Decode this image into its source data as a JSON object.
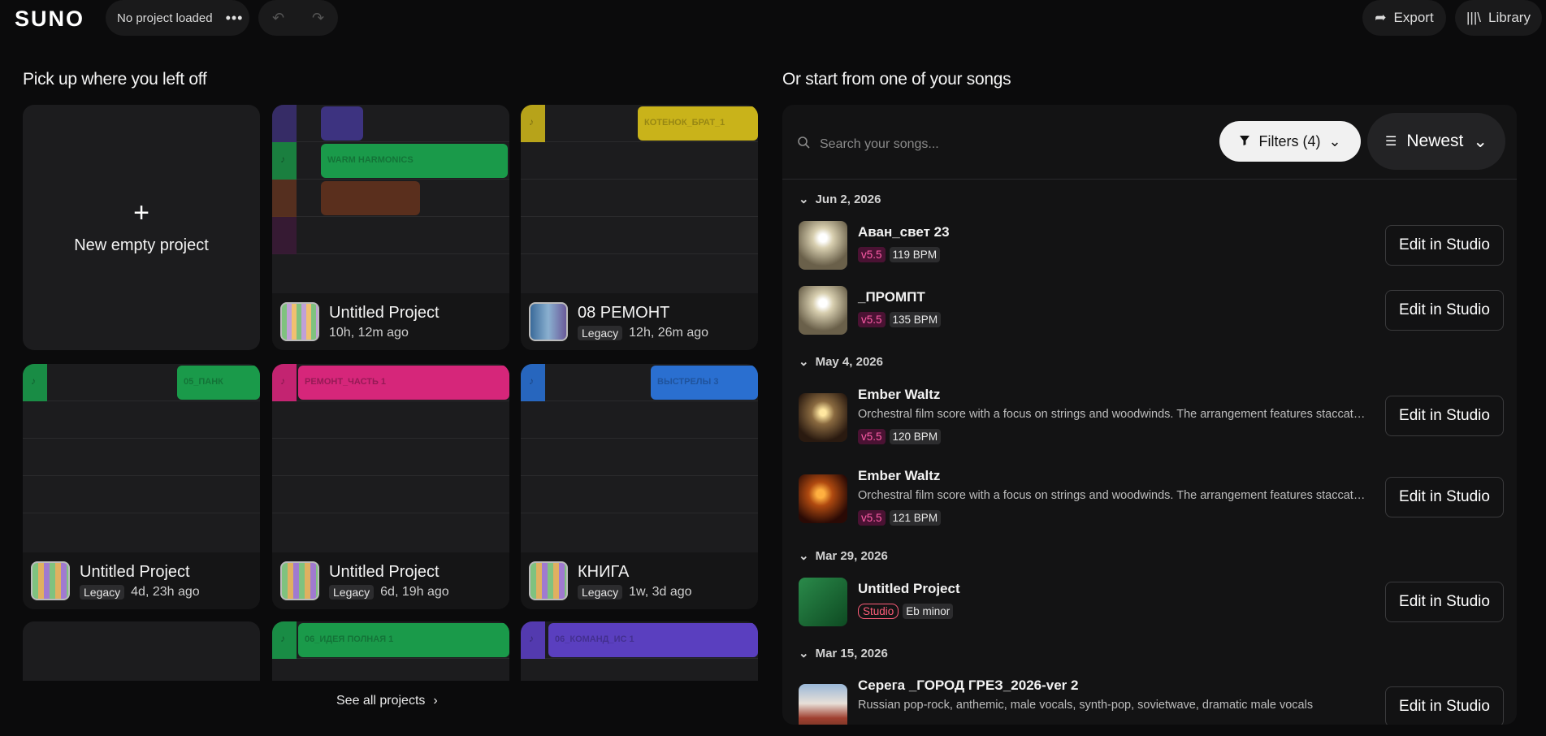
{
  "topbar": {
    "logo": "SUNO",
    "project_status": "No project loaded",
    "more": "•••",
    "export_label": "Export",
    "library_label": "Library"
  },
  "left": {
    "title": "Pick up where you left off",
    "new_project_label": "New empty project",
    "see_all": "See all projects",
    "projects": [
      {
        "name": "Untitled Project",
        "legacy": "",
        "time": "10h, 12m ago"
      },
      {
        "name": "08 РЕМОНТ",
        "legacy": "Legacy",
        "time": "12h, 26m ago"
      },
      {
        "name": "Untitled Project",
        "legacy": "Legacy",
        "time": "4d, 23h ago"
      },
      {
        "name": "Untitled Project",
        "legacy": "Legacy",
        "time": "6d, 19h ago"
      },
      {
        "name": "КНИГА",
        "legacy": "Legacy",
        "time": "1w, 3d ago"
      }
    ],
    "clips": {
      "warm": "WARM HARMONICS",
      "kotenok": "КОТЕНОК_БРАТ_1",
      "pank": "05_ПАНК",
      "remont": "РЕМОНТ_ЧАСТЬ 1",
      "vystrely": "ВЫСТРЕЛЫ 3",
      "ideya": "06_ИДЕЯ ПОЛНАЯ 1",
      "komand": "06_КОМАНД_ИС 1"
    }
  },
  "right": {
    "title": "Or start from one of your songs",
    "search_placeholder": "Search your songs...",
    "filters_label": "Filters (4)",
    "sort_label": "Newest",
    "edit_label": "Edit in Studio",
    "groups": [
      {
        "date": "Jun 2, 2026"
      },
      {
        "date": "May 4, 2026"
      },
      {
        "date": "Mar 29, 2026"
      },
      {
        "date": "Mar 15, 2026"
      }
    ],
    "songs": [
      {
        "title": "Аван_свет 23",
        "desc": "",
        "tag1": "v5.5",
        "tag2": "119 BPM"
      },
      {
        "title": "_ПРОМПТ",
        "desc": "",
        "tag1": "v5.5",
        "tag2": "135 BPM"
      },
      {
        "title": "Ember Waltz",
        "desc": "Orchestral film score with a focus on strings and woodwinds. The arrangement features staccato violins and warm swells",
        "tag1": "v5.5",
        "tag2": "120 BPM"
      },
      {
        "title": "Ember Waltz",
        "desc": "Orchestral film score with a focus on strings and woodwinds. The arrangement features staccato violins and warm swells",
        "tag1": "v5.5",
        "tag2": "121 BPM"
      },
      {
        "title": "Untitled Project",
        "desc": "",
        "tag1": "Studio",
        "tag2": "Eb minor"
      },
      {
        "title": "Серега _ГОРОД ГРЕЗ_2026-ver 2",
        "desc": "Russian pop-rock, anthemic, male vocals, synth-pop, sovietwave, dramatic male vocals",
        "tag1": "",
        "tag2": ""
      }
    ]
  },
  "colors": {
    "accent_pink": "#ff5da8",
    "green": "#1a9a4a",
    "pink": "#d6267a",
    "blue": "#2a6fd0",
    "purple": "#5a3fbf",
    "yellow": "#c9b31a"
  }
}
